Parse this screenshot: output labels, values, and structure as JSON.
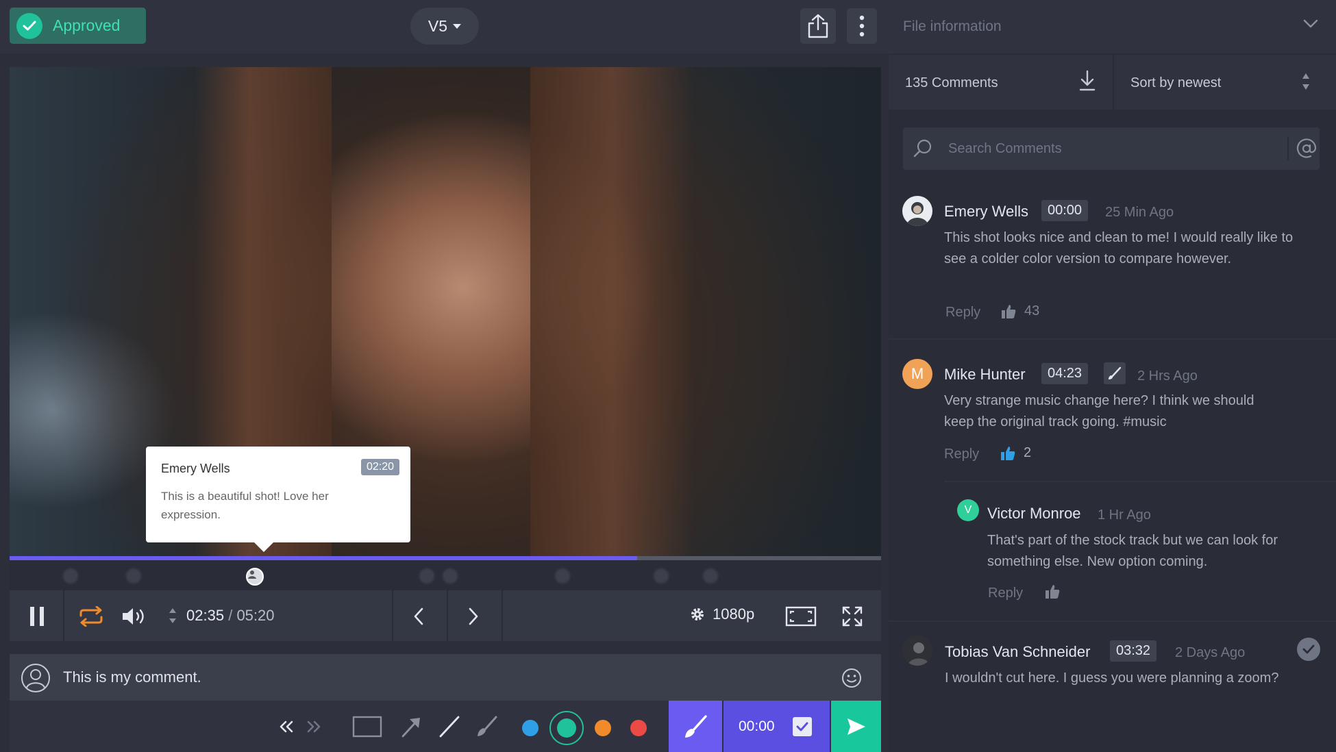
{
  "header": {
    "status_label": "Approved",
    "version_label": "V5"
  },
  "tooltip": {
    "name": "Emery Wells",
    "time": "02:20",
    "text": "This is a beautiful shot! Love her expression."
  },
  "player": {
    "current_time": "02:35",
    "separator": "/",
    "duration": "05:20",
    "progress": 0.72,
    "quality": "1080p"
  },
  "composer": {
    "comment_value": "This is my comment.",
    "timestamp": "00:00",
    "colors": [
      "#2f9fe8",
      "#1fc29b",
      "#f08a2a",
      "#ec4a45"
    ]
  },
  "panel": {
    "title": "File information",
    "comment_count": "135 Comments",
    "sort_label": "Sort by newest",
    "search_placeholder": "Search Comments"
  },
  "comments": [
    {
      "name": "Emery Wells",
      "time": "00:00",
      "ago": "25 Min Ago",
      "text": "This shot looks nice and clean to me! I would really like to see a colder color version to compare however.",
      "reply": "Reply",
      "likes": "43"
    },
    {
      "name": "Mike Hunter",
      "initial": "M",
      "time": "04:23",
      "ago": "2 Hrs Ago",
      "text": "Very strange music change here? I think we should keep the original track going. #music",
      "reply": "Reply",
      "likes": "2",
      "avatar_color": "#f0a356"
    },
    {
      "name": "Victor Monroe",
      "initial": "V",
      "ago": "1 Hr Ago",
      "text": "That's part of the stock track but we can look for something else. New option coming.",
      "reply": "Reply",
      "avatar_color": "#2fcf9a"
    },
    {
      "name": "Tobias Van Schneider",
      "time": "03:32",
      "ago": "2 Days Ago",
      "text": "I wouldn't cut here. I guess you were planning a zoom?"
    }
  ]
}
